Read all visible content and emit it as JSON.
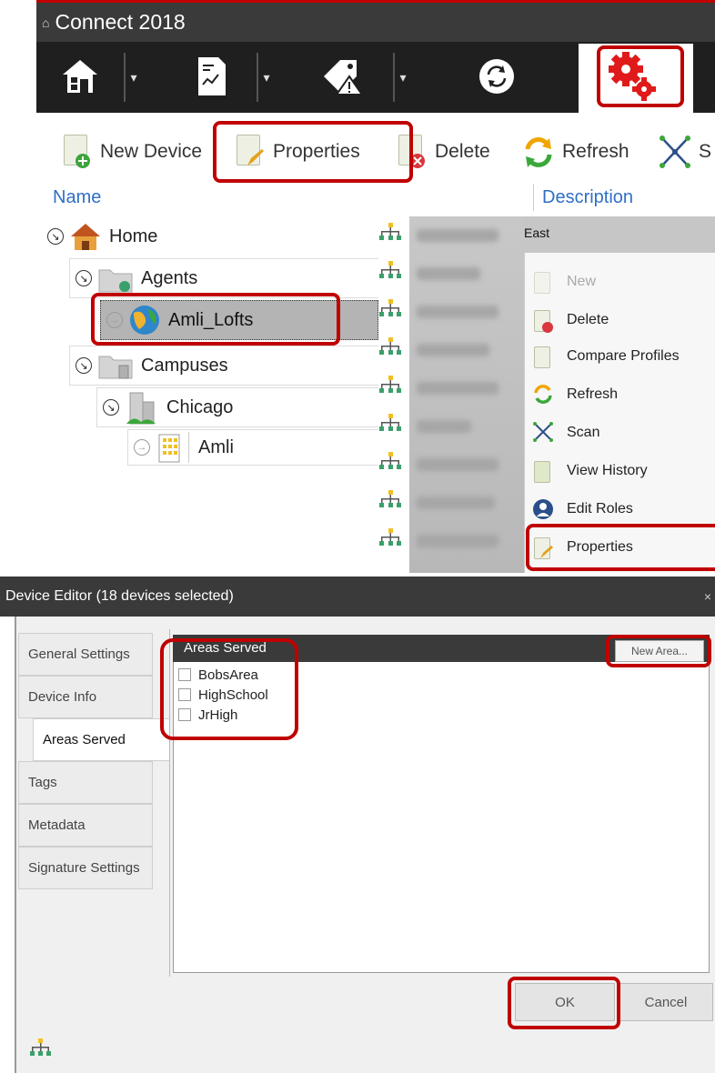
{
  "app": {
    "title": "Connect 2018",
    "logo_text": "⌂"
  },
  "toolbar": {
    "new_device": "New Device",
    "properties": "Properties",
    "delete": "Delete",
    "refresh": "Refresh",
    "scan_partial": "S"
  },
  "columns": {
    "name": "Name",
    "description": "Description"
  },
  "tree": {
    "home": "Home",
    "agents": "Agents",
    "amli_lofts": "Amli_Lofts",
    "campuses": "Campuses",
    "chicago": "Chicago",
    "amli": "Amli"
  },
  "list": {
    "east_label": "East"
  },
  "context_menu": {
    "new": "New",
    "delete": "Delete",
    "compare_profiles": "Compare Profiles",
    "refresh": "Refresh",
    "scan": "Scan",
    "view_history": "View History",
    "edit_roles": "Edit Roles",
    "properties": "Properties"
  },
  "dialog": {
    "title": "Device Editor (18 devices selected)",
    "close": "×",
    "tabs": [
      "General Settings",
      "Device Info",
      "Areas Served",
      "Tags",
      "Metadata",
      "Signature Settings"
    ],
    "active_tab": "Areas Served",
    "areas_header": "Areas Served",
    "new_area_button": "New Area...",
    "areas": [
      "BobsArea",
      "HighSchool",
      "JrHigh"
    ],
    "ok": "OK",
    "cancel": "Cancel"
  },
  "colors": {
    "highlight": "#c00000",
    "dark_bar": "#3a3a3a",
    "link_blue": "#2f6fc6"
  },
  "icons": [
    "home-icon",
    "report-icon",
    "alarm-tag-icon",
    "sync-icon",
    "gears-icon",
    "new-device-icon",
    "properties-icon",
    "delete-icon",
    "refresh-icon",
    "scan-icon",
    "globe-icon",
    "folder-icon",
    "building-icon",
    "network-icon"
  ]
}
